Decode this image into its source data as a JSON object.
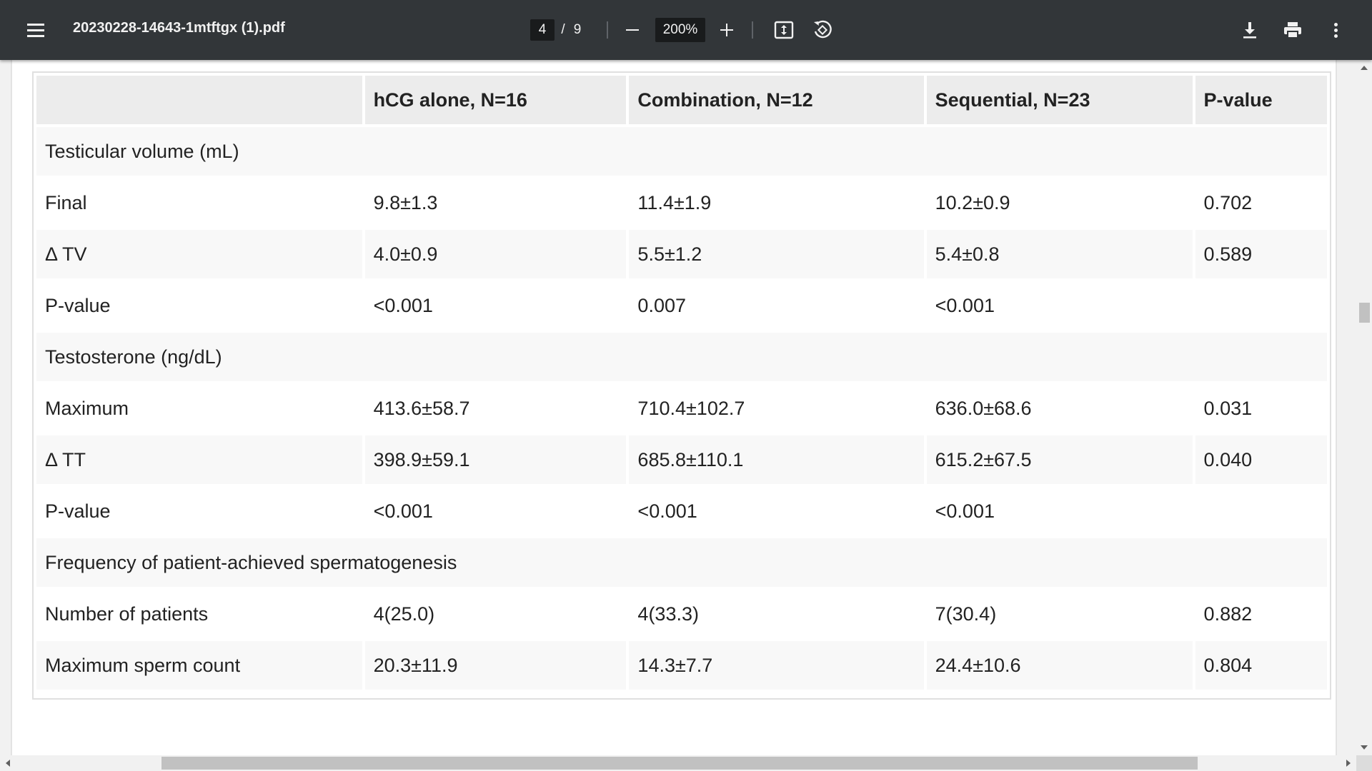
{
  "toolbar": {
    "file_name": "20230228-14643-1mtftgx (1).pdf",
    "current_page": "4",
    "page_separator": "/",
    "total_pages": "9",
    "zoom": "200%",
    "icons": [
      "menu-icon",
      "zoom-out-icon",
      "zoom-in-icon",
      "fit-page-icon",
      "rotate-icon",
      "download-icon",
      "print-icon",
      "more-icon"
    ]
  },
  "table": {
    "headers": [
      "",
      "hCG alone, N=16",
      "Combination, N=12",
      "Sequential, N=23",
      "P-value"
    ],
    "rows": [
      {
        "type": "section",
        "label": "Testicular volume (mL)"
      },
      {
        "type": "data",
        "cells": [
          "Final",
          "9.8±1.3",
          "11.4±1.9",
          "10.2±0.9",
          "0.702"
        ]
      },
      {
        "type": "data",
        "cells": [
          "Δ TV",
          "4.0±0.9",
          "5.5±1.2",
          "5.4±0.8",
          "0.589"
        ]
      },
      {
        "type": "data",
        "cells": [
          "P-value",
          "<0.001",
          "0.007",
          "<0.001",
          ""
        ]
      },
      {
        "type": "section",
        "label": "Testosterone (ng/dL)"
      },
      {
        "type": "data",
        "cells": [
          "Maximum",
          "413.6±58.7",
          "710.4±102.7",
          "636.0±68.6",
          "0.031"
        ]
      },
      {
        "type": "data",
        "cells": [
          "Δ TT",
          "398.9±59.1",
          "685.8±110.1",
          "615.2±67.5",
          "0.040"
        ]
      },
      {
        "type": "data",
        "cells": [
          "P-value",
          "<0.001",
          "<0.001",
          "<0.001",
          ""
        ]
      },
      {
        "type": "section",
        "label": "Frequency of patient-achieved spermatogenesis"
      },
      {
        "type": "data",
        "cells": [
          "Number of patients",
          "4(25.0)",
          "4(33.3)",
          "7(30.4)",
          "0.882"
        ]
      },
      {
        "type": "data",
        "cells": [
          "Maximum sperm count",
          "20.3±11.9",
          "14.3±7.7",
          "24.4±10.6",
          "0.804"
        ]
      }
    ]
  }
}
